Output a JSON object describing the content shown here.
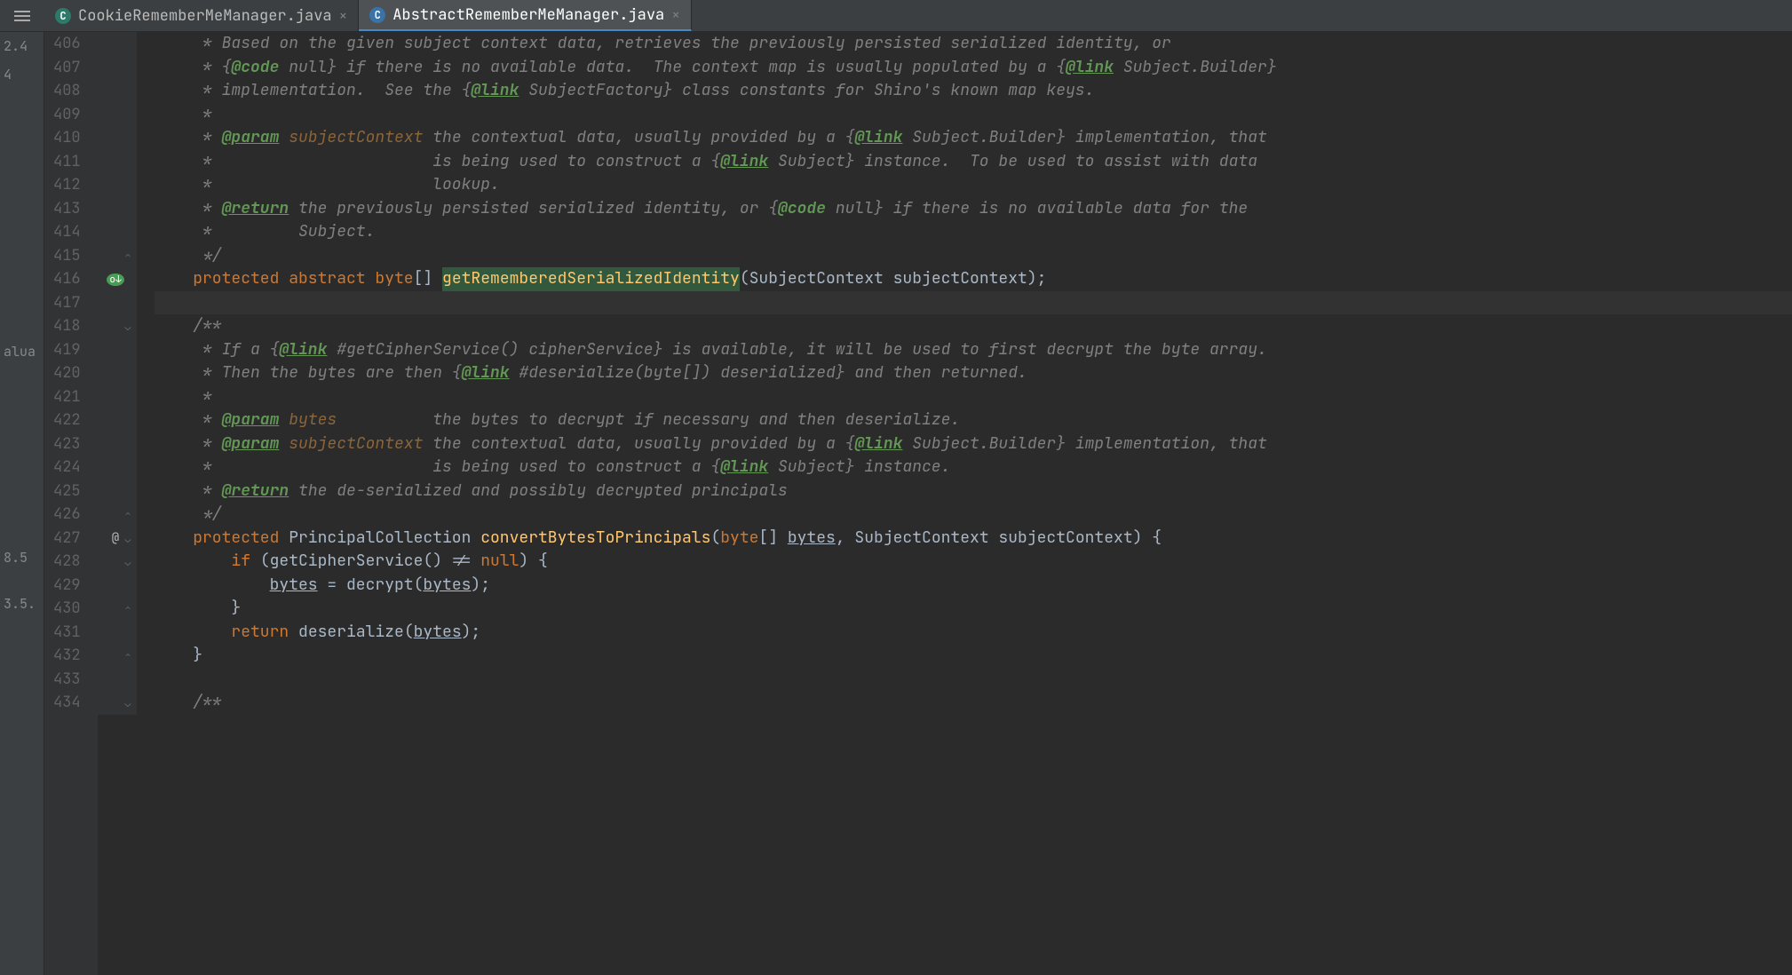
{
  "tabs": [
    {
      "label": "CookieRememberMeManager.java",
      "active": false
    },
    {
      "label": "AbstractRememberMeManager.java",
      "active": true
    }
  ],
  "left_strip": [
    "2.4",
    "4",
    "alua",
    "8.5",
    "3.5."
  ],
  "gutter_markers": {
    "416": "override",
    "427": "at"
  },
  "lines": [
    {
      "n": 406,
      "seg": [
        {
          "t": "     * ",
          "c": "c-comment"
        },
        {
          "t": "Based on the given subject context data, retrieves the previously persisted serialized identity, or",
          "c": "c-comment"
        }
      ]
    },
    {
      "n": 407,
      "seg": [
        {
          "t": "     * {",
          "c": "c-comment"
        },
        {
          "t": "@code",
          "c": "c-doctag-nl"
        },
        {
          "t": " null} if there is no available data.  The context map is usually populated by a {",
          "c": "c-comment"
        },
        {
          "t": "@link",
          "c": "c-doclink"
        },
        {
          "t": " Subject.Builder}",
          "c": "c-comment"
        }
      ]
    },
    {
      "n": 408,
      "seg": [
        {
          "t": "     * implementation.  See the {",
          "c": "c-comment"
        },
        {
          "t": "@link",
          "c": "c-doclink"
        },
        {
          "t": " SubjectFactory} class constants for Shiro's known map keys.",
          "c": "c-comment"
        }
      ]
    },
    {
      "n": 409,
      "seg": [
        {
          "t": "     *",
          "c": "c-comment"
        }
      ]
    },
    {
      "n": 410,
      "seg": [
        {
          "t": "     * ",
          "c": "c-comment"
        },
        {
          "t": "@param",
          "c": "c-doctag"
        },
        {
          "t": " ",
          "c": "c-comment"
        },
        {
          "t": "subjectContext",
          "c": "c-param"
        },
        {
          "t": " the contextual data, usually provided by a {",
          "c": "c-comment"
        },
        {
          "t": "@link",
          "c": "c-doclink"
        },
        {
          "t": " Subject.Builder} implementation, that",
          "c": "c-comment"
        }
      ]
    },
    {
      "n": 411,
      "seg": [
        {
          "t": "     *                       is being used to construct a {",
          "c": "c-comment"
        },
        {
          "t": "@link",
          "c": "c-doclink"
        },
        {
          "t": " Subject} instance.  To be used to assist with data",
          "c": "c-comment"
        }
      ]
    },
    {
      "n": 412,
      "seg": [
        {
          "t": "     *                       lookup.",
          "c": "c-comment"
        }
      ]
    },
    {
      "n": 413,
      "seg": [
        {
          "t": "     * ",
          "c": "c-comment"
        },
        {
          "t": "@return",
          "c": "c-doctag"
        },
        {
          "t": " the previously persisted serialized identity, or {",
          "c": "c-comment"
        },
        {
          "t": "@code",
          "c": "c-doctag-nl"
        },
        {
          "t": " null} if there is no available data for the",
          "c": "c-comment"
        }
      ]
    },
    {
      "n": 414,
      "seg": [
        {
          "t": "     *         Subject.",
          "c": "c-comment"
        }
      ]
    },
    {
      "n": 415,
      "seg": [
        {
          "t": "     */",
          "c": "c-comment"
        }
      ]
    },
    {
      "n": 416,
      "seg": [
        {
          "t": "    ",
          "c": ""
        },
        {
          "t": "protected abstract ",
          "c": "c-keyword"
        },
        {
          "t": "byte",
          "c": "c-keyword"
        },
        {
          "t": "[] ",
          "c": "c-punct"
        },
        {
          "t": "getRememberedSerializedIdentity",
          "c": "c-method-hl"
        },
        {
          "t": "(SubjectContext subjectContext);",
          "c": "c-ident"
        }
      ]
    },
    {
      "n": 417,
      "seg": [
        {
          "t": "",
          "c": ""
        }
      ],
      "caret": true
    },
    {
      "n": 418,
      "seg": [
        {
          "t": "    /**",
          "c": "c-comment"
        }
      ]
    },
    {
      "n": 419,
      "seg": [
        {
          "t": "     * If a {",
          "c": "c-comment"
        },
        {
          "t": "@link",
          "c": "c-doclink"
        },
        {
          "t": " #getCipherService() cipherService} is available, it will be used to first decrypt the byte array.",
          "c": "c-comment"
        }
      ]
    },
    {
      "n": 420,
      "seg": [
        {
          "t": "     * Then the bytes are then {",
          "c": "c-comment"
        },
        {
          "t": "@link",
          "c": "c-doclink"
        },
        {
          "t": " #deserialize(byte[]) deserialized} and then returned.",
          "c": "c-comment"
        }
      ]
    },
    {
      "n": 421,
      "seg": [
        {
          "t": "     *",
          "c": "c-comment"
        }
      ]
    },
    {
      "n": 422,
      "seg": [
        {
          "t": "     * ",
          "c": "c-comment"
        },
        {
          "t": "@param",
          "c": "c-doctag"
        },
        {
          "t": " ",
          "c": "c-comment"
        },
        {
          "t": "bytes",
          "c": "c-param"
        },
        {
          "t": "          the bytes to decrypt if necessary and then deserialize.",
          "c": "c-comment"
        }
      ]
    },
    {
      "n": 423,
      "seg": [
        {
          "t": "     * ",
          "c": "c-comment"
        },
        {
          "t": "@param",
          "c": "c-doctag"
        },
        {
          "t": " ",
          "c": "c-comment"
        },
        {
          "t": "subjectContext",
          "c": "c-param"
        },
        {
          "t": " the contextual data, usually provided by a {",
          "c": "c-comment"
        },
        {
          "t": "@link",
          "c": "c-doclink"
        },
        {
          "t": " Subject.Builder} implementation, that",
          "c": "c-comment"
        }
      ]
    },
    {
      "n": 424,
      "seg": [
        {
          "t": "     *                       is being used to construct a {",
          "c": "c-comment"
        },
        {
          "t": "@link",
          "c": "c-doclink"
        },
        {
          "t": " Subject} instance.",
          "c": "c-comment"
        }
      ]
    },
    {
      "n": 425,
      "seg": [
        {
          "t": "     * ",
          "c": "c-comment"
        },
        {
          "t": "@return",
          "c": "c-doctag"
        },
        {
          "t": " the de-serialized and possibly decrypted principals",
          "c": "c-comment"
        }
      ]
    },
    {
      "n": 426,
      "seg": [
        {
          "t": "     */",
          "c": "c-comment"
        }
      ]
    },
    {
      "n": 427,
      "seg": [
        {
          "t": "    ",
          "c": ""
        },
        {
          "t": "protected ",
          "c": "c-keyword"
        },
        {
          "t": "PrincipalCollection ",
          "c": "c-type"
        },
        {
          "t": "convertBytesToPrincipals",
          "c": "c-method"
        },
        {
          "t": "(",
          "c": "c-punct"
        },
        {
          "t": "byte",
          "c": "c-keyword"
        },
        {
          "t": "[] ",
          "c": "c-punct"
        },
        {
          "t": "bytes",
          "c": "c-ident c-under"
        },
        {
          "t": ", SubjectContext subjectContext) {",
          "c": "c-ident"
        }
      ]
    },
    {
      "n": 428,
      "seg": [
        {
          "t": "        ",
          "c": ""
        },
        {
          "t": "if ",
          "c": "c-keyword"
        },
        {
          "t": "(getCipherService() != ",
          "c": "c-ident"
        },
        {
          "t": "null",
          "c": "c-keyword"
        },
        {
          "t": ") {",
          "c": "c-ident"
        }
      ]
    },
    {
      "n": 429,
      "seg": [
        {
          "t": "            ",
          "c": ""
        },
        {
          "t": "bytes",
          "c": "c-ident c-under"
        },
        {
          "t": " = decrypt(",
          "c": "c-ident"
        },
        {
          "t": "bytes",
          "c": "c-ident c-under"
        },
        {
          "t": ");",
          "c": "c-ident"
        }
      ]
    },
    {
      "n": 430,
      "seg": [
        {
          "t": "        }",
          "c": "c-ident"
        }
      ]
    },
    {
      "n": 431,
      "seg": [
        {
          "t": "        ",
          "c": ""
        },
        {
          "t": "return ",
          "c": "c-keyword"
        },
        {
          "t": "deserialize(",
          "c": "c-ident"
        },
        {
          "t": "bytes",
          "c": "c-ident c-under"
        },
        {
          "t": ");",
          "c": "c-ident"
        }
      ]
    },
    {
      "n": 432,
      "seg": [
        {
          "t": "    }",
          "c": "c-ident"
        }
      ]
    },
    {
      "n": 433,
      "seg": [
        {
          "t": "",
          "c": ""
        }
      ]
    },
    {
      "n": 434,
      "seg": [
        {
          "t": "    /**",
          "c": "c-comment"
        }
      ]
    }
  ]
}
